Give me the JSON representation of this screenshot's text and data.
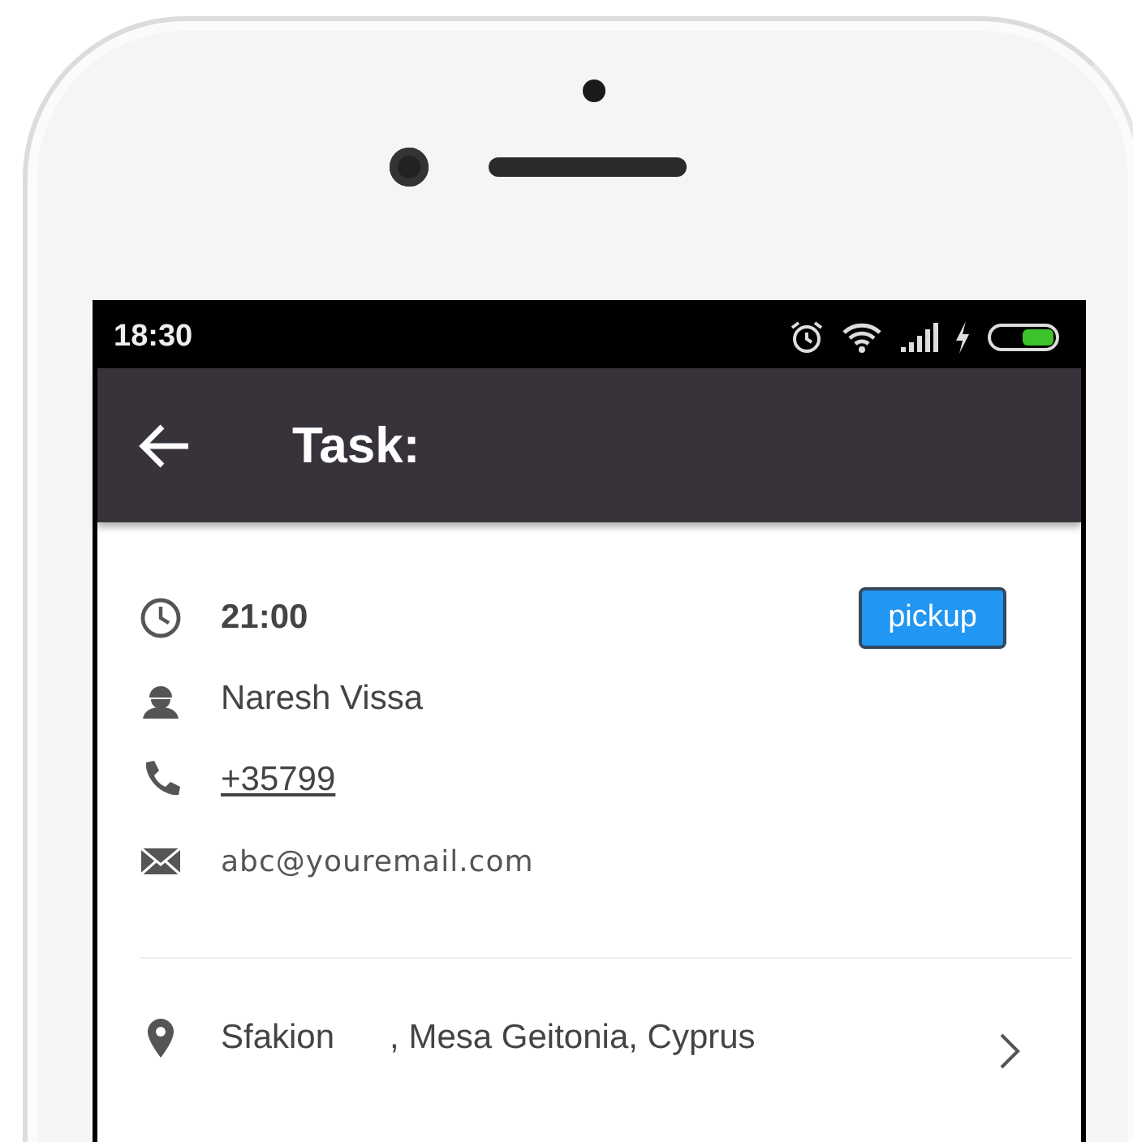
{
  "status_bar": {
    "time": "18:30"
  },
  "app_bar": {
    "title": "Task:"
  },
  "task": {
    "time": "21:00",
    "type": "pickup",
    "name": "Naresh Vissa",
    "phone": "+35799",
    "email": "abc@youremail.com"
  },
  "address": {
    "street": "Sfakion",
    "rest": ", Mesa Geitonia, Cyprus"
  }
}
